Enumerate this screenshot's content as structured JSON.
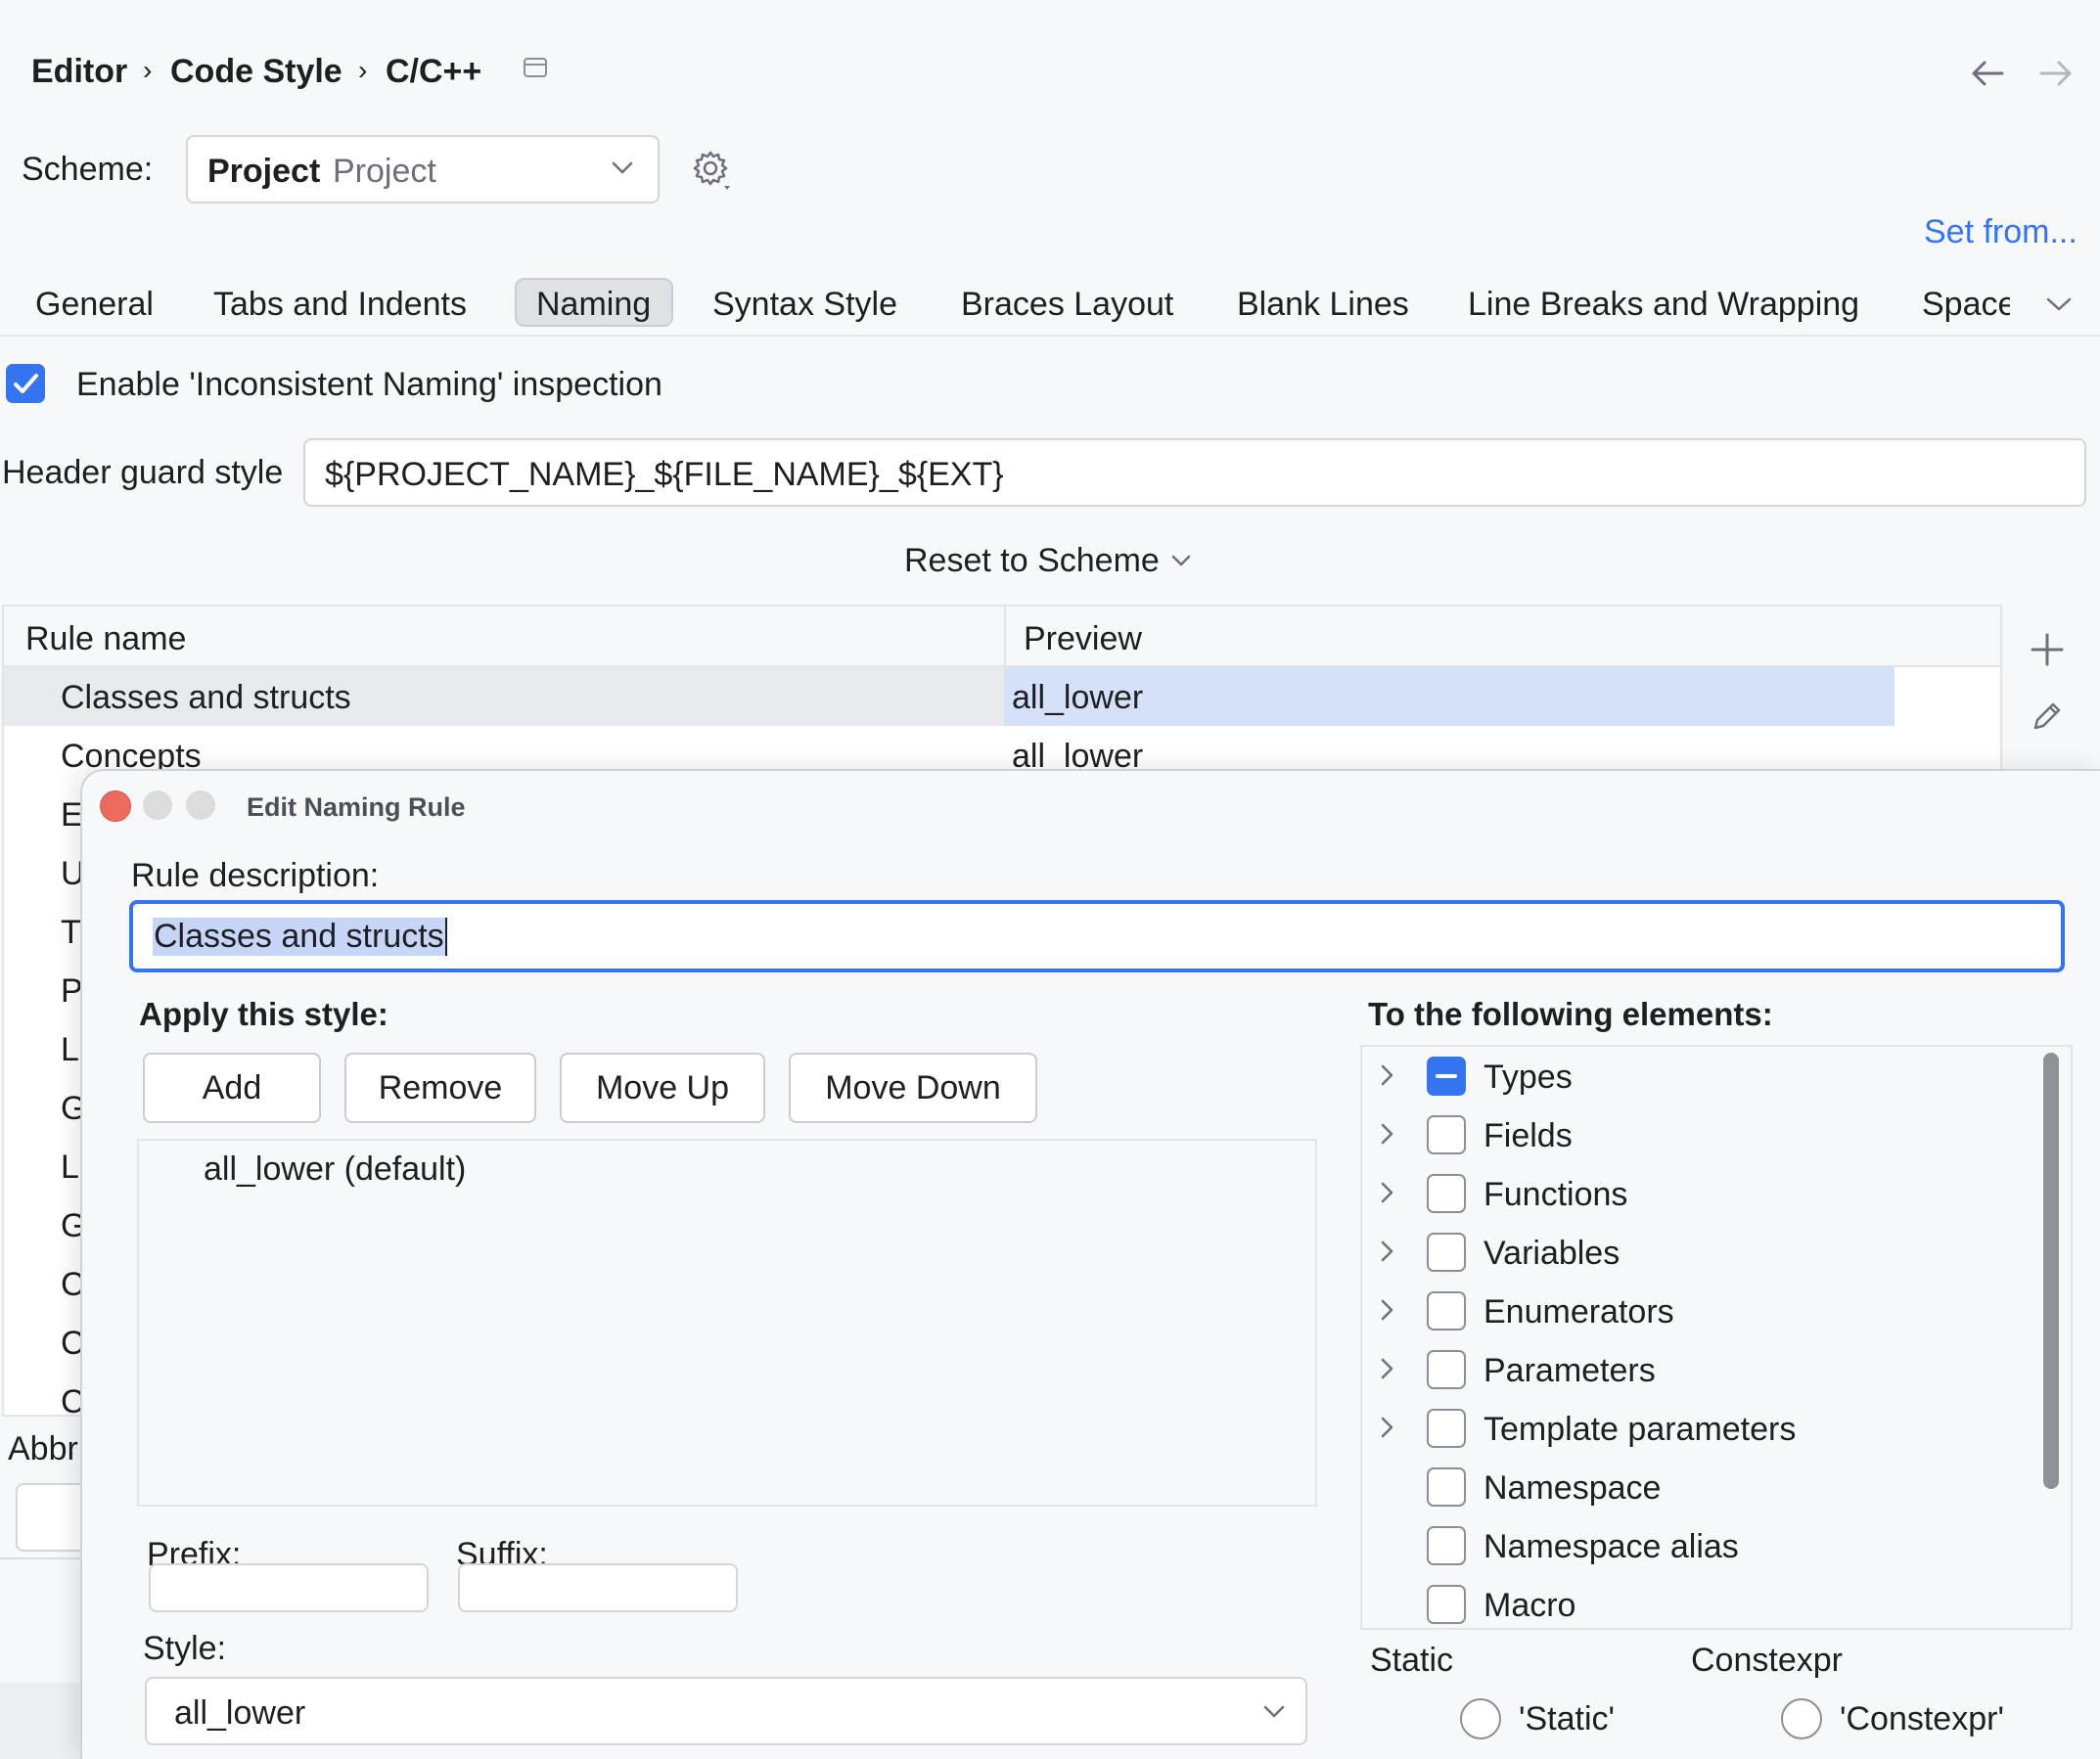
{
  "breadcrumb": {
    "items": [
      "Editor",
      "Code Style",
      "C/C++"
    ]
  },
  "scheme": {
    "label": "Scheme:",
    "value": "Project",
    "value_secondary": "Project"
  },
  "set_from": "Set from...",
  "tabs": [
    {
      "label": "General",
      "selected": false
    },
    {
      "label": "Tabs and Indents",
      "selected": false
    },
    {
      "label": "Naming",
      "selected": true
    },
    {
      "label": "Syntax Style",
      "selected": false
    },
    {
      "label": "Braces Layout",
      "selected": false
    },
    {
      "label": "Blank Lines",
      "selected": false
    },
    {
      "label": "Line Breaks and Wrapping",
      "selected": false
    },
    {
      "label": "Space",
      "selected": false
    }
  ],
  "inspection": {
    "label": "Enable 'Inconsistent Naming' inspection",
    "checked": true
  },
  "header_guard": {
    "label": "Header guard style",
    "value": "${PROJECT_NAME}_${FILE_NAME}_${EXT}"
  },
  "reset_label": "Reset to Scheme",
  "rules_table": {
    "headers": [
      "Rule name",
      "Preview"
    ],
    "rows": [
      {
        "name": "Classes and structs",
        "preview": "all_lower"
      },
      {
        "name": "Concepts",
        "preview": "all_lower"
      }
    ],
    "hidden_initials": [
      "E",
      "U",
      "T",
      "P",
      "L",
      "G",
      "L",
      "G",
      "C",
      "C",
      "C"
    ]
  },
  "abbr_label": "Abbr",
  "dialog": {
    "title": "Edit Naming Rule",
    "rule_description_label": "Rule description:",
    "rule_description_value": "Classes and structs",
    "apply_label": "Apply this style:",
    "buttons": [
      "Add",
      "Remove",
      "Move Up",
      "Move Down"
    ],
    "styles": [
      "all_lower (default)"
    ],
    "prefix_label": "Prefix:",
    "suffix_label": "Suffix:",
    "style_label": "Style:",
    "style_value": "all_lower",
    "elements_label": "To the following elements:",
    "elements": [
      {
        "label": "Types",
        "state": "mixed",
        "expandable": true
      },
      {
        "label": "Fields",
        "state": "off",
        "expandable": true
      },
      {
        "label": "Functions",
        "state": "off",
        "expandable": true
      },
      {
        "label": "Variables",
        "state": "off",
        "expandable": true
      },
      {
        "label": "Enumerators",
        "state": "off",
        "expandable": true
      },
      {
        "label": "Parameters",
        "state": "off",
        "expandable": true
      },
      {
        "label": "Template parameters",
        "state": "off",
        "expandable": true
      },
      {
        "label": "Namespace",
        "state": "off",
        "expandable": false
      },
      {
        "label": "Namespace alias",
        "state": "off",
        "expandable": false
      },
      {
        "label": "Macro",
        "state": "off",
        "expandable": false
      }
    ],
    "static_label": "Static",
    "static_option": "'Static'",
    "constexpr_label": "Constexpr",
    "constexpr_option": "'Constexpr'"
  },
  "colors": {
    "accent": "#3574f0",
    "selection": "#d5e0f9",
    "close": "#ed6a5e"
  }
}
